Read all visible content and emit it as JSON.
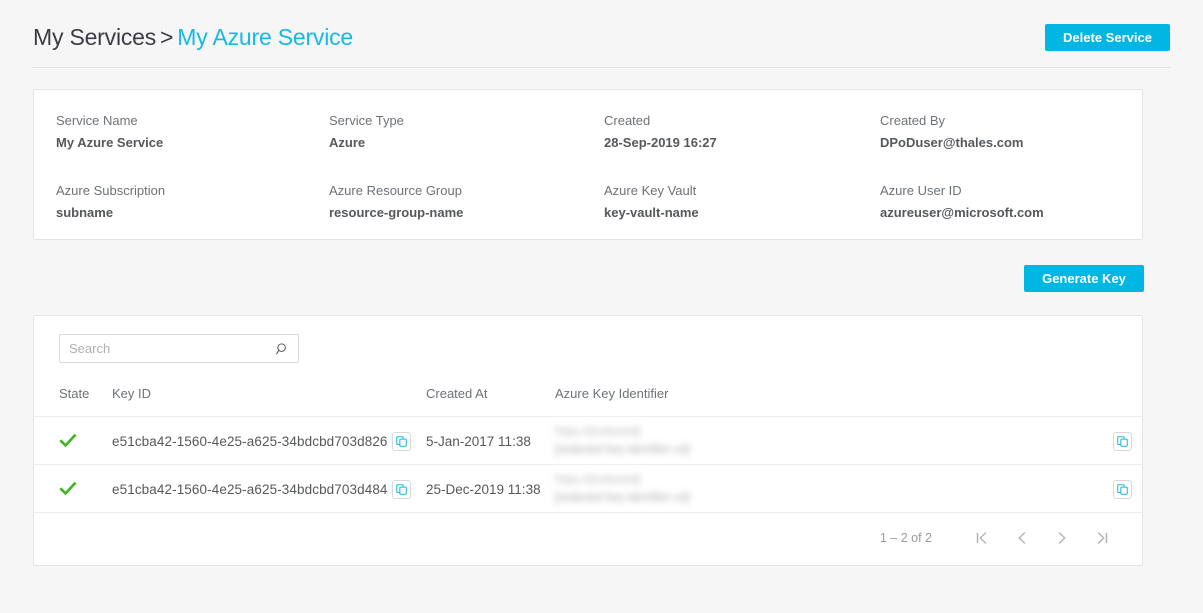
{
  "header": {
    "breadcrumb_root": "My Services",
    "breadcrumb_separator": ">",
    "breadcrumb_current": "My Azure Service",
    "delete_button": "Delete Service"
  },
  "service_info": {
    "fields": [
      {
        "label": "Service Name",
        "value": "My Azure Service"
      },
      {
        "label": "Service Type",
        "value": "Azure"
      },
      {
        "label": "Created",
        "value": "28-Sep-2019 16:27"
      },
      {
        "label": "Created By",
        "value": "DPoDuser@thales.com"
      },
      {
        "label": "Azure Subscription",
        "value": "subname"
      },
      {
        "label": "Azure Resource Group",
        "value": "resource-group-name"
      },
      {
        "label": "Azure Key Vault",
        "value": "key-vault-name"
      },
      {
        "label": "Azure User ID",
        "value": "azureuser@microsoft.com"
      }
    ]
  },
  "actions": {
    "generate_key_button": "Generate Key"
  },
  "keys_panel": {
    "search_placeholder": "Search",
    "search_value": "",
    "columns": [
      "State",
      "Key ID",
      "Created At",
      "Azure Key Identifier"
    ],
    "rows": [
      {
        "state": "active",
        "state_icon": "green-check-icon",
        "key_id": "e51cba42-1560-4e25-a625-34bdcbd703d826",
        "created_at": "5-Jan-2017 11:38",
        "azure_key_identifier_line1": "https://[redacted]",
        "azure_key_identifier_line2": "[redacted key identifier url]",
        "azure_key_identifier_redacted": true
      },
      {
        "state": "active",
        "state_icon": "green-check-icon",
        "key_id": "e51cba42-1560-4e25-a625-34bdcbd703d484",
        "created_at": "25-Dec-2019 11:38",
        "azure_key_identifier_line1": "https://[redacted]",
        "azure_key_identifier_line2": "[redacted key identifier url]",
        "azure_key_identifier_redacted": true
      }
    ],
    "pagination": {
      "range_label": "1 – 2 of 2",
      "first_label": "first page",
      "prev_label": "previous page",
      "next_label": "next page",
      "last_label": "last page"
    }
  },
  "colors": {
    "accent": "#00b7e4",
    "link": "#16b9e3",
    "success": "#3cb521",
    "page_background": "#f6f6f6",
    "card_background": "#ffffff",
    "border": "#e4e4e4",
    "label_text": "#6d7278",
    "value_text": "#55585c"
  }
}
